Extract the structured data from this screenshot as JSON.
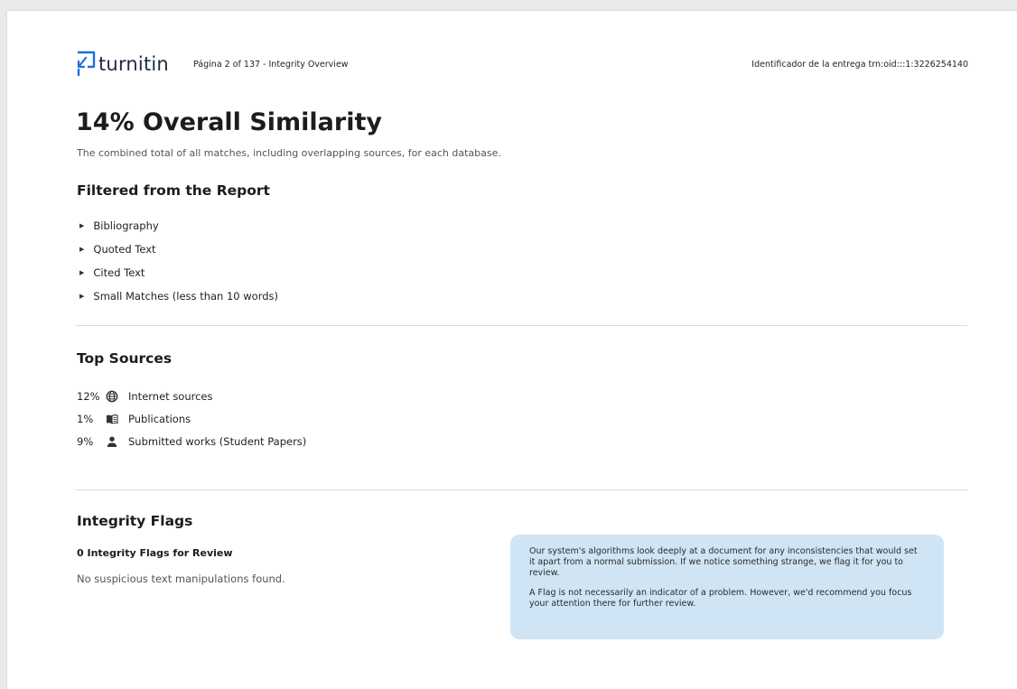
{
  "header": {
    "logo_text": "turnitin",
    "page_info": "Página 2 of 137 - Integrity Overview",
    "submission_id": "Identificador de la entrega trn:oid:::1:3226254140"
  },
  "overview": {
    "title": "14% Overall Similarity",
    "subtitle": "The combined total of all matches, including overlapping sources, for each database."
  },
  "filtered": {
    "heading": "Filtered from the Report",
    "items": [
      "Bibliography",
      "Quoted Text",
      "Cited Text",
      "Small Matches (less than 10 words)"
    ]
  },
  "top_sources": {
    "heading": "Top Sources",
    "rows": [
      {
        "percent": "12%",
        "icon": "globe-icon",
        "label": "Internet sources"
      },
      {
        "percent": "1%",
        "icon": "book-icon",
        "label": "Publications"
      },
      {
        "percent": "9%",
        "icon": "person-icon",
        "label": "Submitted works (Student Papers)"
      }
    ]
  },
  "integrity": {
    "heading": "Integrity Flags",
    "count_label": "0 Integrity Flags for Review",
    "none_text": "No suspicious text manipulations found.",
    "info_p1": "Our system's algorithms look deeply at a document for any inconsistencies that would set it apart from a normal submission. If we notice something strange, we flag it for you to review.",
    "info_p2": "A Flag is not necessarily an indicator of a problem. However, we'd recommend you focus your attention there for further review."
  },
  "colors": {
    "brand_blue": "#1e6fd9",
    "info_box_bg": "#cfe5f6"
  }
}
